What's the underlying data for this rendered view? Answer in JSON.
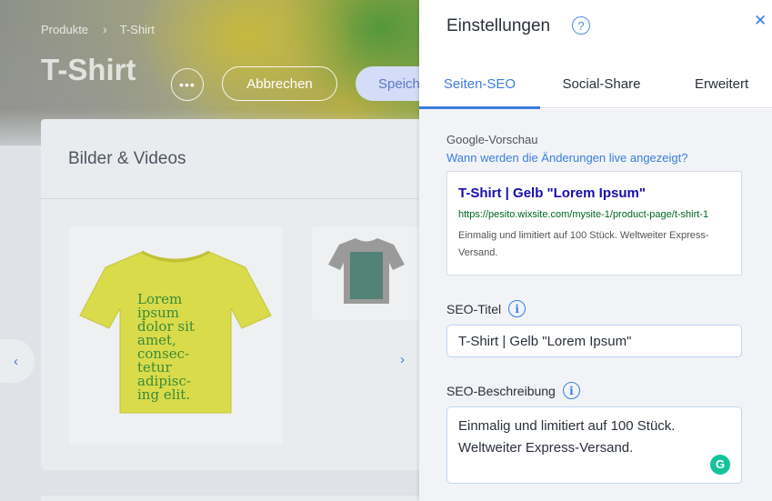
{
  "background": {
    "breadcrumb": {
      "parent": "Produkte",
      "separator": "›",
      "current": "T-Shirt"
    },
    "page_title": "T-Shirt",
    "more_label": "•••",
    "cancel_label": "Abbrechen",
    "save_label": "Speich",
    "media_section_title": "Bilder & Videos",
    "next_arrow": "›",
    "prev_arrow": "‹"
  },
  "panel": {
    "title": "Einstellungen",
    "help_icon": "?",
    "close_icon": "✕",
    "tabs": [
      {
        "label": "Seiten-SEO",
        "active": true
      },
      {
        "label": "Social-Share",
        "active": false
      },
      {
        "label": "Erweitert",
        "active": false
      }
    ],
    "google_preview": {
      "section_label": "Google-Vorschau",
      "link": "Wann werden die Änderungen live angezeigt?",
      "title": "T-Shirt | Gelb \"Lorem Ipsum\"",
      "url": "https://pesito.wixsite.com/mysite-1/product-page/t-shirt-1",
      "description": "Einmalig und limitiert auf 100 Stück. Weltweiter Express-Versand."
    },
    "seo_title": {
      "label": "SEO-Titel",
      "info_icon": "i",
      "value": "T-Shirt | Gelb \"Lorem Ipsum\""
    },
    "seo_description": {
      "label": "SEO-Beschreibung",
      "info_icon": "i",
      "value": "Einmalig und limitiert auf 100 Stück. Weltweiter Express-Versand.",
      "grammarly_icon": "G"
    }
  },
  "colors": {
    "accent": "#3b7de0",
    "google_title": "#1a0dab",
    "google_url": "#006621",
    "grammarly": "#15c39a"
  }
}
